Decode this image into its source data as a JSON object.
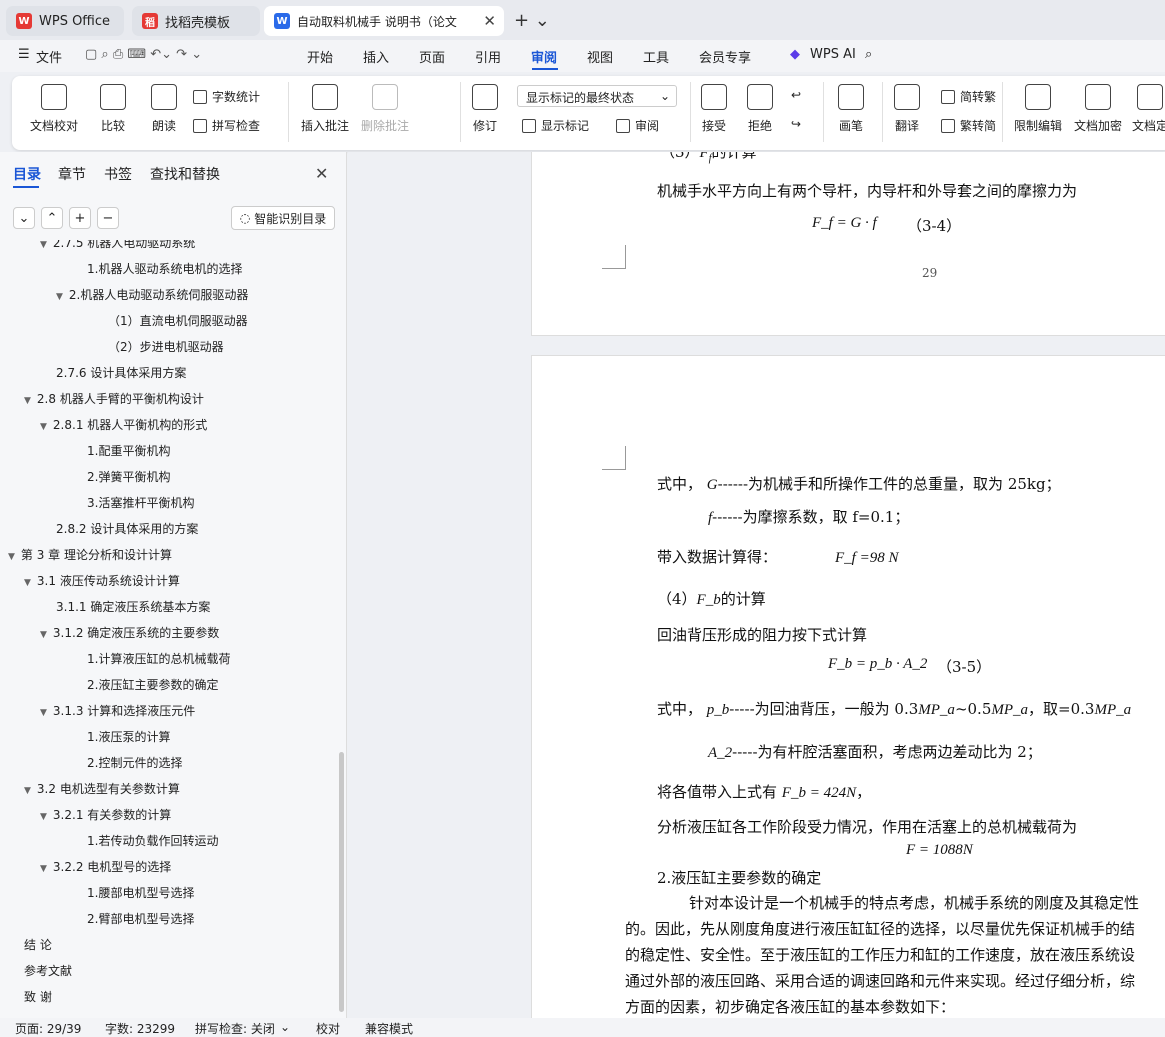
{
  "tabs": [
    {
      "label": "WPS Office"
    },
    {
      "label": "找稻壳模板"
    },
    {
      "label": "自动取料机械手 说明书（论文"
    }
  ],
  "menu": {
    "file": "文件",
    "items": [
      "开始",
      "插入",
      "页面",
      "引用",
      "审阅",
      "视图",
      "工具",
      "会员专享"
    ],
    "active": "审阅",
    "wps_ai": "WPS AI"
  },
  "ribbon": {
    "doc_check": "文档校对",
    "compare": "比较",
    "read": "朗读",
    "word_count": "字数统计",
    "spell_check": "拼写检查",
    "insert_comment": "插入批注",
    "delete_comment": "删除批注",
    "revise": "修订",
    "markup_state": "显示标记的最终状态",
    "show_markup": "显示标记",
    "review": "审阅",
    "accept": "接受",
    "reject": "拒绝",
    "pen": "画笔",
    "translate": "翻译",
    "to_trad": "简转繁",
    "to_simp": "繁转简",
    "restrict": "限制编辑",
    "encrypt": "文档加密",
    "doc_more": "文档定"
  },
  "sidebar": {
    "tabs": [
      "目录",
      "章节",
      "书签",
      "查找和替换"
    ],
    "smart_toc": "智能识别目录",
    "toc": [
      {
        "label": "2.7.5 机器人电动驱动系统",
        "level": 2,
        "arrow": true
      },
      {
        "label": "1.机器人驱动系统电机的选择",
        "level": 4
      },
      {
        "label": "2.机器人电动驱动系统伺服驱动器",
        "level": 3,
        "arrow": true
      },
      {
        "label": "（1）直流电机伺服驱动器",
        "level": 5
      },
      {
        "label": "（2）步进电机驱动器",
        "level": 5
      },
      {
        "label": "2.7.6 设计具体采用方案",
        "level": 2
      },
      {
        "label": "2.8  机器人手臂的平衡机构设计",
        "level": 1,
        "arrow": true
      },
      {
        "label": "2.8.1 机器人平衡机构的形式",
        "level": 2,
        "arrow": true
      },
      {
        "label": "1.配重平衡机构",
        "level": 4
      },
      {
        "label": "2.弹簧平衡机构",
        "level": 4
      },
      {
        "label": "3.活塞推杆平衡机构",
        "level": 4
      },
      {
        "label": "2.8.2 设计具体采用的方案",
        "level": 2
      },
      {
        "label": "第 3 章  理论分析和设计计算",
        "level": 0,
        "arrow": true
      },
      {
        "label": "3.1 液压传动系统设计计算",
        "level": 1,
        "arrow": true
      },
      {
        "label": "3.1.1 确定液压系统基本方案",
        "level": 2
      },
      {
        "label": "3.1.2 确定液压系统的主要参数",
        "level": 2,
        "arrow": true
      },
      {
        "label": "1.计算液压缸的总机械载荷",
        "level": 4
      },
      {
        "label": "2.液压缸主要参数的确定",
        "level": 4
      },
      {
        "label": "3.1.3 计算和选择液压元件",
        "level": 2,
        "arrow": true
      },
      {
        "label": "1.液压泵的计算",
        "level": 4
      },
      {
        "label": "2.控制元件的选择",
        "level": 4
      },
      {
        "label": "3.2  电机选型有关参数计算",
        "level": 1,
        "arrow": true
      },
      {
        "label": "3.2.1 有关参数的计算",
        "level": 2,
        "arrow": true
      },
      {
        "label": "1.若传动负载作回转运动",
        "level": 4
      },
      {
        "label": "3.2.2 电机型号的选择",
        "level": 2,
        "arrow": true
      },
      {
        "label": "1.腰部电机型号选择",
        "level": 4
      },
      {
        "label": "2.臂部电机型号选择",
        "level": 4
      },
      {
        "label": "结  论",
        "level": 0
      },
      {
        "label": "参考文献",
        "level": 0
      },
      {
        "label": "致  谢",
        "level": 0
      }
    ]
  },
  "document": {
    "p1_heading": "（3）",
    "p1_heading_sym": "F",
    "p1_heading_sub": "f",
    "p1_heading_tail": "的计算",
    "p1_line": "机械手水平方向上有两个导杆，内导杆和外导套之间的摩擦力为",
    "p1_formula": "F_f = G · f",
    "p1_eqno": "（3-4）",
    "page_number": "29",
    "l1_a": "式中，",
    "l1_b": "G",
    "l1_c": "------为机械手和所操作工件的总重量，取为 25kg；",
    "l2_a": "f",
    "l2_b": "------为摩擦系数，取 f=0.1；",
    "l3_a": "带入数据计算得：",
    "l3_b": "F_f =98 N",
    "h4_a": "（4）",
    "h4_b": "F_b",
    "h4_c": "的计算",
    "l5": "回油背压形成的阻力按下式计算",
    "formula2": "F_b = p_b · A_2",
    "eqno2": "（3-5）",
    "l6_a": "式中，",
    "l6_b": "p_b",
    "l6_c": "-----为回油背压，一般为 0.3",
    "l6_d": "MP_a",
    "l6_e": "~0.5",
    "l6_f": "MP_a",
    "l6_g": "，取=0.3",
    "l6_h": "MP_a",
    "l7_a": "A_2",
    "l7_b": "-----为有杆腔活塞面积，考虑两边差动比为 2；",
    "l8_a": "将各值带入上式有",
    "l8_b": "F_b = 424N",
    "l8_c": "，",
    "l9": "分析液压缸各工作阶段受力情况，作用在活塞上的总机械载荷为",
    "formula3": "F = 1088N",
    "h10": "2.液压缸主要参数的确定",
    "para": [
      "针对本设计是一个机械手的特点考虑，机械手系统的刚度及其稳定性",
      "的。因此，先从刚度角度进行液压缸缸径的选择，以尽量优先保证机械手的结",
      "的稳定性、安全性。至于液压缸的工作压力和缸的工作速度，放在液压系统设",
      "通过外部的液压回路、采用合适的调速回路和元件来实现。经过仔细分析，综",
      "方面的因素，初步确定各液压缸的基本参数如下："
    ]
  },
  "status": {
    "page": "页面: 29/39",
    "words": "字数: 23299",
    "spell": "拼写检查: 关闭",
    "proof": "校对",
    "compat": "兼容模式"
  }
}
